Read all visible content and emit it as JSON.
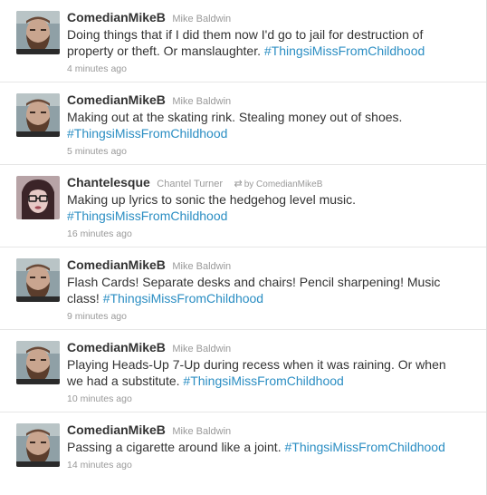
{
  "tweets": [
    {
      "screen_name": "ComedianMikeB",
      "full_name": "Mike Baldwin",
      "text": "Doing things that if I did them now I'd go to jail for destruction of property or theft. Or manslaughter. ",
      "hashtag": "#ThingsiMissFromChildhood",
      "time": "4 minutes ago",
      "avatar": "bearded-man"
    },
    {
      "screen_name": "ComedianMikeB",
      "full_name": "Mike Baldwin",
      "text": "Making out at the skating rink. Stealing money out of shoes. ",
      "hashtag": "#ThingsiMissFromChildhood",
      "time": "5 minutes ago",
      "avatar": "bearded-man"
    },
    {
      "screen_name": "Chantelesque",
      "full_name": "Chantel Turner",
      "retweet_icon": "retweet-icon",
      "retweet_by": "by ComedianMikeB",
      "text": "Making up lyrics to sonic the hedgehog level music. ",
      "hashtag": "#ThingsiMissFromChildhood",
      "time": "16 minutes ago",
      "avatar": "woman-glasses"
    },
    {
      "screen_name": "ComedianMikeB",
      "full_name": "Mike Baldwin",
      "text": "Flash Cards! Separate desks and chairs! Pencil sharpening! Music class! ",
      "hashtag": "#ThingsiMissFromChildhood",
      "time": "9 minutes ago",
      "avatar": "bearded-man"
    },
    {
      "screen_name": "ComedianMikeB",
      "full_name": "Mike Baldwin",
      "text": "Playing Heads-Up 7-Up during recess when it was raining. Or when we had a substitute. ",
      "hashtag": "#ThingsiMissFromChildhood",
      "time": "10 minutes ago",
      "avatar": "bearded-man"
    },
    {
      "screen_name": "ComedianMikeB",
      "full_name": "Mike Baldwin",
      "text": "Passing a cigarette around like a joint. ",
      "hashtag": "#ThingsiMissFromChildhood",
      "time": "14 minutes ago",
      "avatar": "bearded-man"
    }
  ],
  "colors": {
    "link": "#2b8ec3",
    "meta": "#999999",
    "text": "#333333",
    "divider": "#e6e6e6"
  }
}
